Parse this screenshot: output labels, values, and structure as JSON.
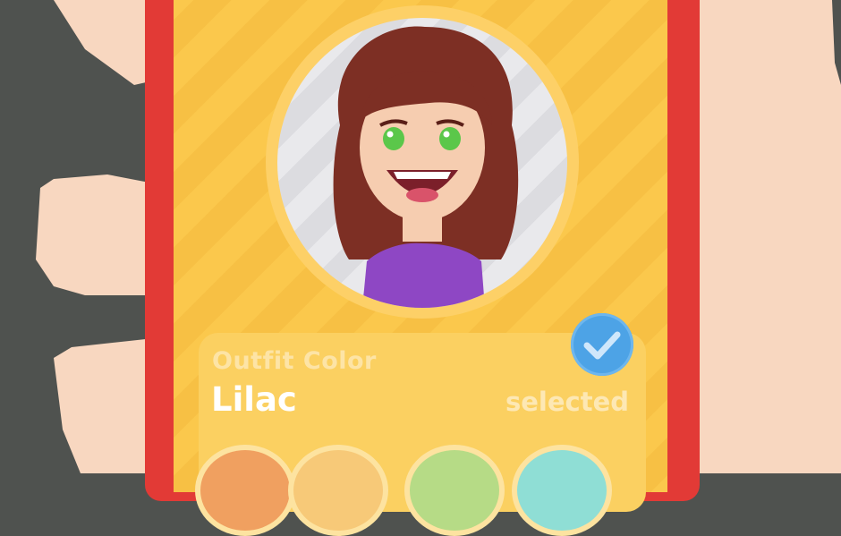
{
  "customization": {
    "category_label": "Outfit Color",
    "selected_value": "Lilac",
    "status": "selected"
  },
  "swatches": [
    {
      "color": "#f0a060"
    },
    {
      "color": "#f7c978"
    },
    {
      "color": "#b6db86"
    },
    {
      "color": "#8fded5"
    }
  ],
  "avatar": {
    "hair_color": "#7d2f24",
    "eye_color": "#5bc74a",
    "outfit_color": "#8e47c4",
    "skin_color": "#f6cdb0"
  },
  "icons": {
    "badge": "checkmark-icon"
  }
}
